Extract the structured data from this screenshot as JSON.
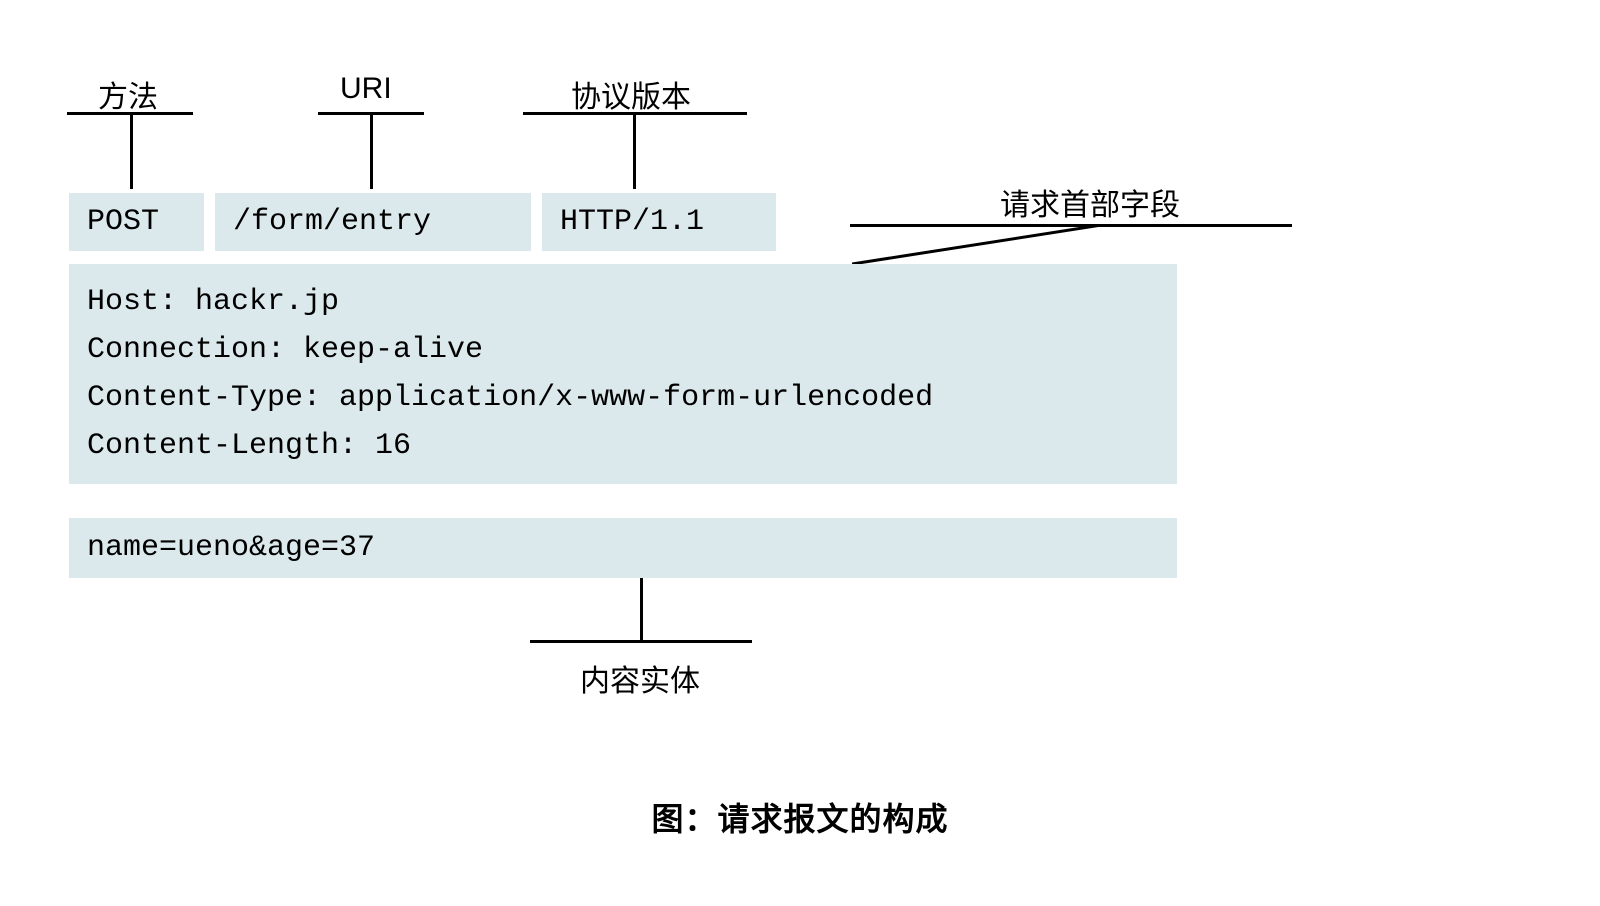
{
  "labels": {
    "method": "方法",
    "uri": "URI",
    "protocol": "协议版本",
    "headers_label": "请求首部字段",
    "body_label": "内容实体"
  },
  "request_line": {
    "method": "POST",
    "uri": "/form/entry",
    "protocol": "HTTP/1.1"
  },
  "headers": [
    "Host: hackr.jp",
    "Connection: keep-alive",
    "Content-Type: application/x-www-form-urlencoded",
    "Content-Length: 16"
  ],
  "body": "name=ueno&age=37",
  "caption": "图：请求报文的构成"
}
